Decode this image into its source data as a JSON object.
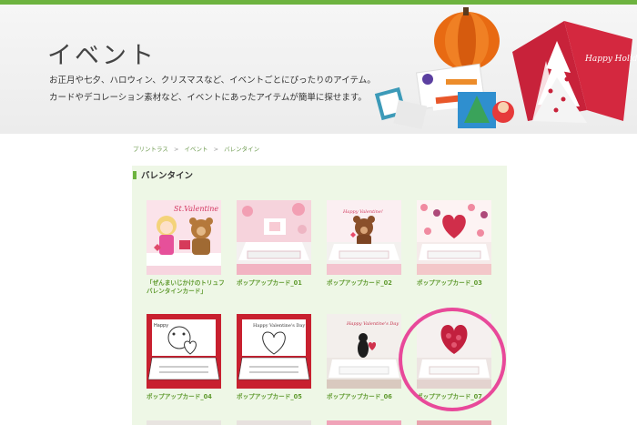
{
  "hero": {
    "title": "イベント",
    "desc_line1": "お正月や七夕、ハロウィン、クリスマスなど、イベントごとにぴったりのアイテム。",
    "desc_line2": "カードやデコレーション素材など、イベントにあったアイテムが簡単に探せます。",
    "card_text": "Happy Holidays!"
  },
  "breadcrumb": [
    "プリントラス",
    "イベント",
    "バレンタイン"
  ],
  "section": {
    "title": "バレンタイン"
  },
  "items": [
    {
      "caption1": "「ぜんまいじかけのトリュフ",
      "caption2": "バレンタインカード」"
    },
    {
      "caption1": "ポップアップカード_01"
    },
    {
      "caption1": "ポップアップカード_02"
    },
    {
      "caption1": "ポップアップカード_03"
    },
    {
      "caption1": "ポップアップカード_04"
    },
    {
      "caption1": "ポップアップカード_05"
    },
    {
      "caption1": "ポップアップカード_06"
    },
    {
      "caption1": "ポップアップカード_07"
    }
  ],
  "colors": {
    "accent_green": "#6db33f",
    "highlight_pink": "#e8499a",
    "panel_bg": "#eef7e6"
  }
}
